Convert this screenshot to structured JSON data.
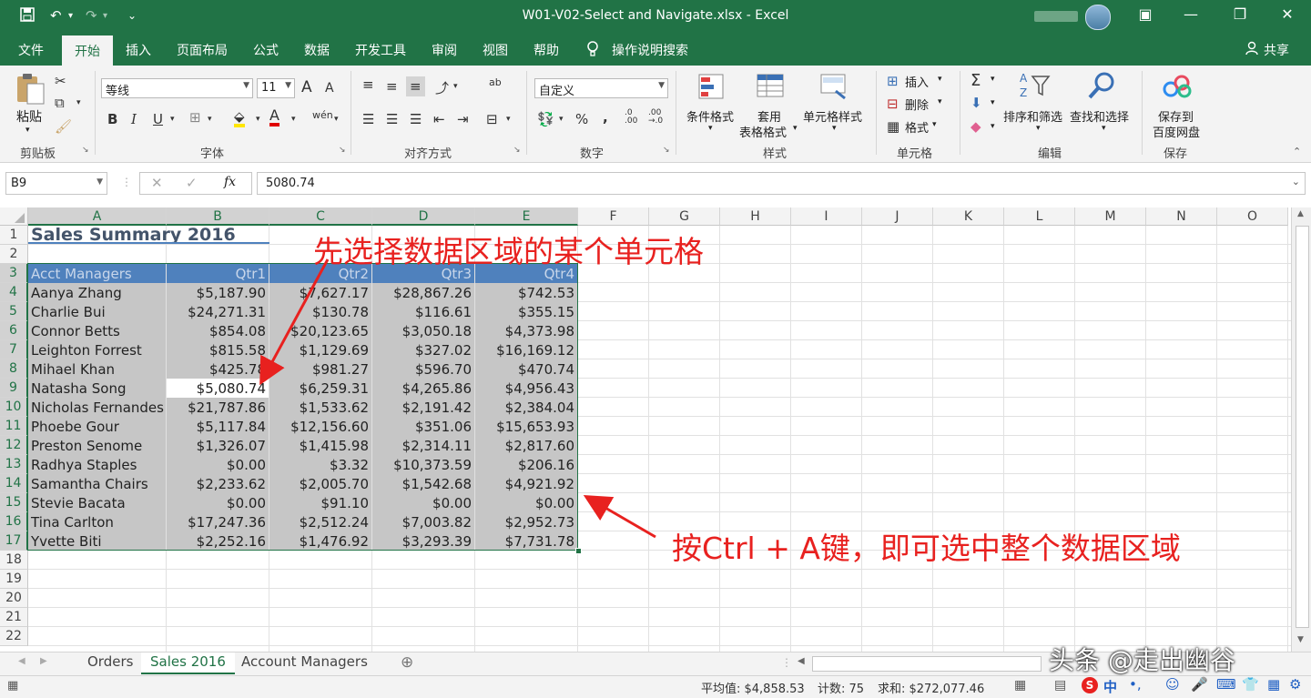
{
  "window": {
    "title": "W01-V02-Select and Navigate.xlsx  -  Excel",
    "qa_save_icon": "save-icon",
    "qa_undo": "↶",
    "qa_redo": "↷",
    "qa_customize": "⌄"
  },
  "tabs": [
    "文件",
    "开始",
    "插入",
    "页面布局",
    "公式",
    "数据",
    "开发工具",
    "审阅",
    "视图",
    "帮助"
  ],
  "active_tab": "开始",
  "tell_me": "操作说明搜索",
  "share": "共享",
  "ribbon": {
    "clipboard": {
      "paste": "粘贴",
      "label": "剪贴板"
    },
    "font": {
      "name": "等线",
      "size": "11",
      "label": "字体",
      "bold": "B",
      "italic": "I",
      "underline": "U",
      "grow": "A",
      "shrink": "A",
      "wen": "wén"
    },
    "alignment": {
      "label": "对齐方式",
      "wrap": "ab"
    },
    "number": {
      "format": "自定义",
      "label": "数字",
      "percent": "%",
      "comma": ","
    },
    "styles": {
      "conditional": "条件格式",
      "table_l1": "套用",
      "table_l2": "表格格式",
      "cell_styles": "单元格样式",
      "label": "样式"
    },
    "cells": {
      "insert": "插入",
      "delete": "删除",
      "format": "格式",
      "label": "单元格"
    },
    "editing": {
      "sort_filter": "排序和筛选",
      "find_select": "查找和选择",
      "label": "编辑"
    },
    "save": {
      "l1": "保存到",
      "l2": "百度网盘",
      "label": "保存"
    }
  },
  "formula_bar": {
    "name_box": "B9",
    "fx": "fx",
    "value": "5080.74"
  },
  "columns": [
    "A",
    "B",
    "C",
    "D",
    "E",
    "F",
    "G",
    "H",
    "I",
    "J",
    "K",
    "L",
    "M",
    "N",
    "O"
  ],
  "rows": [
    "1",
    "2",
    "3",
    "4",
    "5",
    "6",
    "7",
    "8",
    "9",
    "10",
    "11",
    "12",
    "13",
    "14",
    "15",
    "16",
    "17",
    "18",
    "19",
    "20",
    "21",
    "22"
  ],
  "sheet": {
    "title": "Sales Summary 2016",
    "header": [
      "Acct Managers",
      "Qtr1",
      "Qtr2",
      "Qtr3",
      "Qtr4"
    ],
    "data": [
      [
        "Aanya Zhang",
        "$5,187.90",
        "$7,627.17",
        "$28,867.26",
        "$742.53"
      ],
      [
        "Charlie Bui",
        "$24,271.31",
        "$130.78",
        "$116.61",
        "$355.15"
      ],
      [
        "Connor Betts",
        "$854.08",
        "$20,123.65",
        "$3,050.18",
        "$4,373.98"
      ],
      [
        "Leighton Forrest",
        "$815.58",
        "$1,129.69",
        "$327.02",
        "$16,169.12"
      ],
      [
        "Mihael Khan",
        "$425.78",
        "$981.27",
        "$596.70",
        "$470.74"
      ],
      [
        "Natasha Song",
        "$5,080.74",
        "$6,259.31",
        "$4,265.86",
        "$4,956.43"
      ],
      [
        "Nicholas Fernandes",
        "$21,787.86",
        "$1,533.62",
        "$2,191.42",
        "$2,384.04"
      ],
      [
        "Phoebe Gour",
        "$5,117.84",
        "$12,156.60",
        "$351.06",
        "$15,653.93"
      ],
      [
        "Preston Senome",
        "$1,326.07",
        "$1,415.98",
        "$2,314.11",
        "$2,817.60"
      ],
      [
        "Radhya Staples",
        "$0.00",
        "$3.32",
        "$10,373.59",
        "$206.16"
      ],
      [
        "Samantha Chairs",
        "$2,233.62",
        "$2,005.70",
        "$1,542.68",
        "$4,921.92"
      ],
      [
        "Stevie Bacata",
        "$0.00",
        "$91.10",
        "$0.00",
        "$0.00"
      ],
      [
        "Tina Carlton",
        "$17,247.36",
        "$2,512.24",
        "$7,003.82",
        "$2,952.73"
      ],
      [
        "Yvette Biti",
        "$2,252.16",
        "$1,476.92",
        "$3,293.39",
        "$7,731.78"
      ]
    ]
  },
  "sheet_tabs": [
    "Orders",
    "Sales 2016",
    "Account Managers"
  ],
  "active_sheet": "Sales 2016",
  "status": {
    "average": "平均值: $4,858.53",
    "count": "计数: 75",
    "sum": "求和: $272,077.46"
  },
  "annotations": {
    "top": "先选择数据区域的某个单元格",
    "bottom": "按Ctrl + A键，即可选中整个数据区域"
  },
  "watermark": "头条 @走出幽谷",
  "ime": "中",
  "colors": {
    "excel_green": "#217346",
    "header_fill": "#4f81bd",
    "selection_fill": "#c6c6c6",
    "annotation_red": "#e8211f"
  }
}
